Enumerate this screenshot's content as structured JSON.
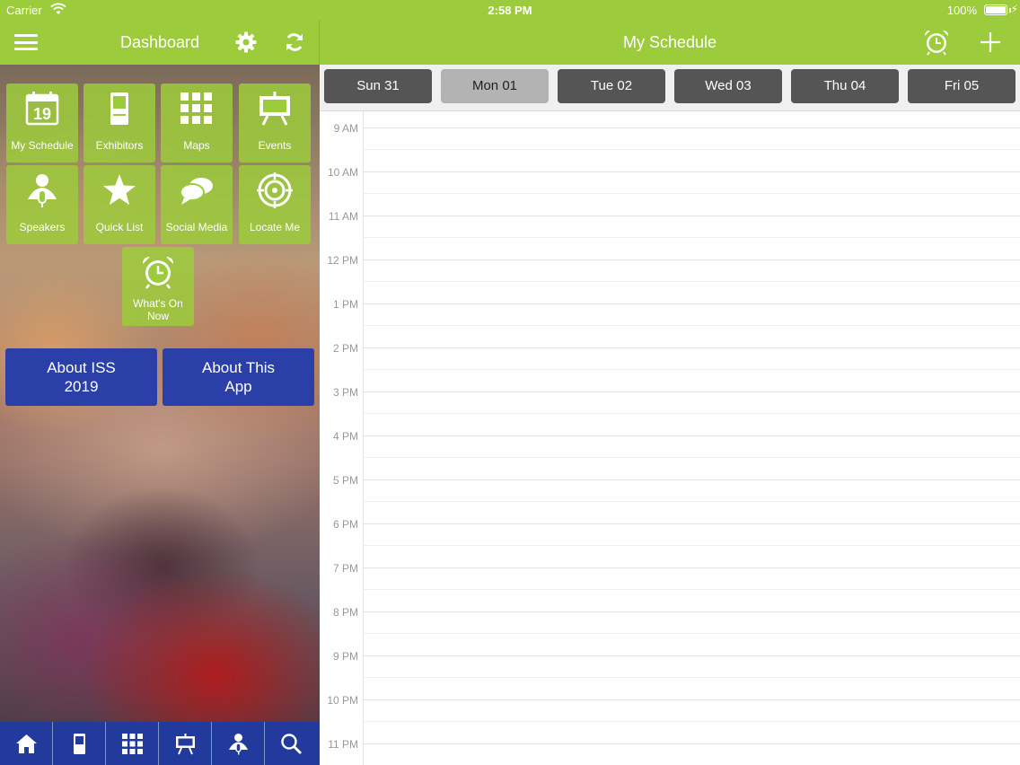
{
  "status_bar": {
    "carrier": "Carrier",
    "time": "2:58 PM",
    "battery": "100%"
  },
  "dashboard": {
    "title": "Dashboard"
  },
  "schedule": {
    "title": "My Schedule"
  },
  "tiles": [
    {
      "label": "My Schedule",
      "icon": "calendar-icon",
      "calendar_day": "19"
    },
    {
      "label": "Exhibitors",
      "icon": "kiosk-icon"
    },
    {
      "label": "Maps",
      "icon": "grid-map-icon"
    },
    {
      "label": "Events",
      "icon": "easel-icon"
    },
    {
      "label": "Speakers",
      "icon": "speaker-icon"
    },
    {
      "label": "Quick List",
      "icon": "star-icon"
    },
    {
      "label": "Social Media",
      "icon": "chat-bubbles-icon"
    },
    {
      "label": "Locate Me",
      "icon": "target-icon"
    },
    {
      "label": "What's On Now",
      "icon": "alarm-clock-icon"
    }
  ],
  "about_buttons": [
    {
      "label": "About ISS 2019"
    },
    {
      "label": "About This App"
    }
  ],
  "tab_bar": [
    {
      "icon": "home-icon"
    },
    {
      "icon": "kiosk-icon"
    },
    {
      "icon": "grid-map-icon"
    },
    {
      "icon": "easel-icon"
    },
    {
      "icon": "speaker-icon"
    },
    {
      "icon": "search-icon"
    }
  ],
  "days": [
    {
      "label": "Sun 31",
      "selected": false
    },
    {
      "label": "Mon 01",
      "selected": true
    },
    {
      "label": "Tue 02",
      "selected": false
    },
    {
      "label": "Wed 03",
      "selected": false
    },
    {
      "label": "Thu 04",
      "selected": false
    },
    {
      "label": "Fri 05",
      "selected": false
    }
  ],
  "hours": [
    "9 AM",
    "10 AM",
    "11 AM",
    "12 PM",
    "1 PM",
    "2 PM",
    "3 PM",
    "4 PM",
    "5 PM",
    "6 PM",
    "7 PM",
    "8 PM",
    "9 PM",
    "10 PM",
    "11 PM"
  ],
  "colors": {
    "header_green": "#9ccb3b",
    "tile_green": "#9ccb3b",
    "about_blue": "#2a40a8",
    "tabbar_blue": "#223a9c",
    "day_button": "#555555",
    "day_selected": "#b3b3b3"
  }
}
